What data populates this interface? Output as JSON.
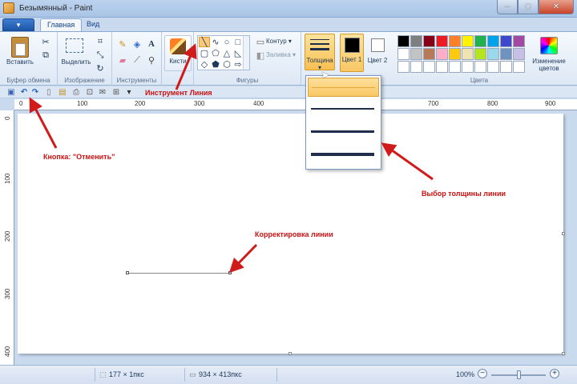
{
  "window": {
    "title": "Безымянный - Paint",
    "min": "─",
    "max": "□",
    "close": "✕"
  },
  "menu_button": "▾",
  "tabs": [
    {
      "label": "Главная"
    },
    {
      "label": "Вид"
    }
  ],
  "groups": {
    "clipboard": {
      "label": "Буфер обмена",
      "paste": "Вставить"
    },
    "image": {
      "label": "Изображение",
      "select": "Выделить"
    },
    "tools": {
      "label": "Инструменты"
    },
    "brushes": {
      "label": "Кисти"
    },
    "shapes": {
      "label": "Фигуры",
      "outline": "Контур ▾",
      "fill": "Заливка ▾"
    },
    "thickness": {
      "label": "Толщина"
    },
    "colors": {
      "label": "Цвета",
      "color1": "Цвет 1",
      "color2": "Цвет 2",
      "edit": "Изменение цветов"
    }
  },
  "colors": {
    "palette": [
      "#000000",
      "#7f7f7f",
      "#880015",
      "#ed1c24",
      "#ff7f27",
      "#fff200",
      "#22b14c",
      "#00a2e8",
      "#3f48cc",
      "#a349a4",
      "#ffffff",
      "#c3c3c3",
      "#b97a57",
      "#ffaec9",
      "#ffc90e",
      "#efe4b0",
      "#b5e61d",
      "#99d9ea",
      "#7092be",
      "#c8bfe7",
      "#ffffff",
      "#ffffff",
      "#ffffff",
      "#ffffff",
      "#ffffff",
      "#ffffff",
      "#ffffff",
      "#ffffff",
      "#ffffff",
      "#ffffff"
    ],
    "color1": "#000000",
    "color2": "#ffffff"
  },
  "ruler_top": [
    "0",
    "100",
    "200",
    "300",
    "400",
    "700",
    "800",
    "900"
  ],
  "ruler_left": [
    "0",
    "100",
    "200",
    "300",
    "400"
  ],
  "annotations": {
    "undo": "Кнопка: \"Отменить\"",
    "line_tool": "Инструмент Линия",
    "thickness": "Выбор толщины линии",
    "line_adjust": "Корректировка линии"
  },
  "status": {
    "selection": "177 × 1пкс",
    "canvas_size": "934 × 413пкс",
    "zoom": "100%",
    "zoom_out": "−",
    "zoom_in": "+"
  }
}
